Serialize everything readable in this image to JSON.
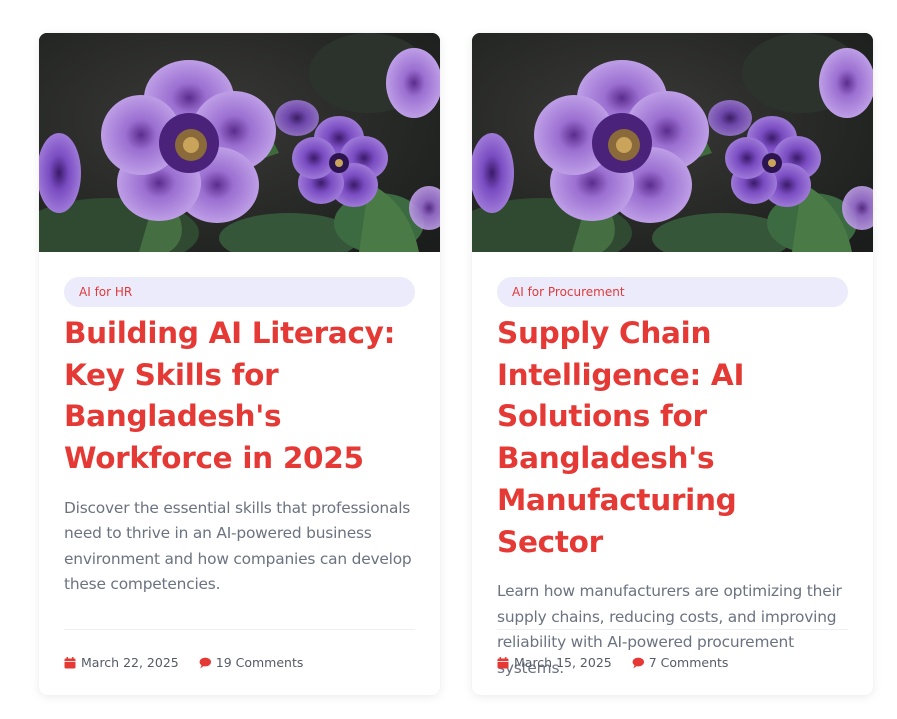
{
  "posts": [
    {
      "category": "AI for HR",
      "title": "Building AI Literacy: Key Skills for Bangladesh's Workforce in 2025",
      "excerpt": "Discover the essential skills that professionals need to thrive in an AI-powered business environment and how companies can develop these competencies.",
      "date": "March 22, 2025",
      "comments": "19 Comments"
    },
    {
      "category": "AI for Procurement",
      "title": "Supply Chain Intelligence: AI Solutions for Bangladesh's Manufacturing Sector",
      "excerpt": "Learn how manufacturers are optimizing their supply chains, reducing costs, and improving reliability with AI-powered procurement systems.",
      "date": "March 15, 2025",
      "comments": "7 Comments"
    }
  ],
  "colors": {
    "accent": "#e53935",
    "tag_bg": "#ecebfb",
    "text_muted": "#6b7280"
  },
  "icons": {
    "date": "calendar-icon",
    "comments": "comment-bubble-icon",
    "image": "purple-petunia-flower-photo"
  }
}
